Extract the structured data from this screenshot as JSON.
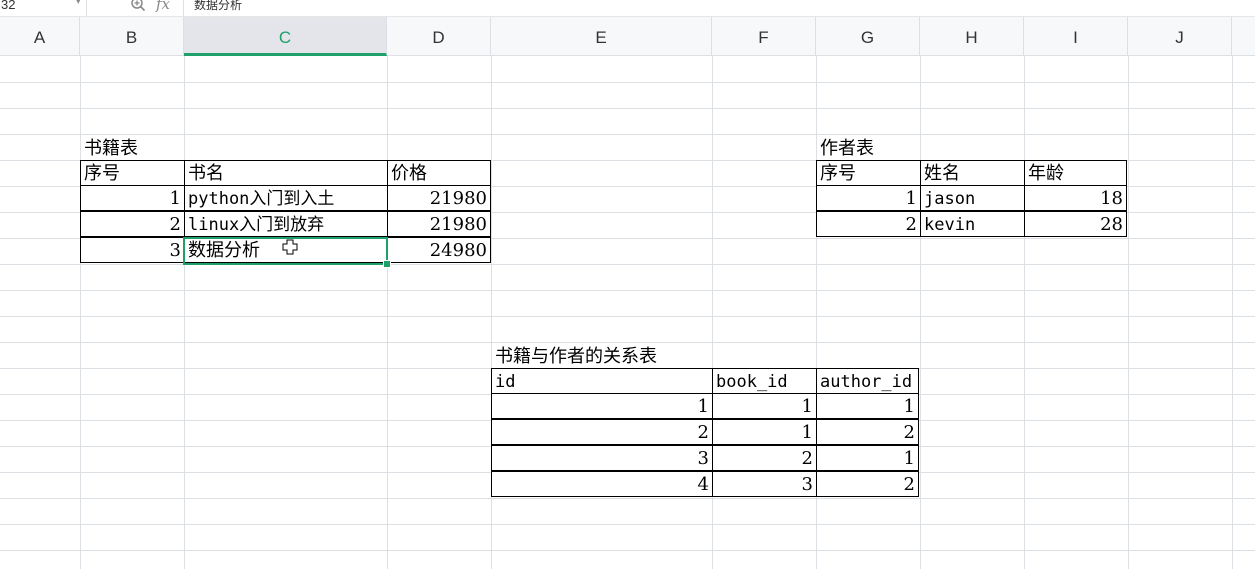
{
  "formula_bar": {
    "name_box": "32",
    "fx_label": "fx",
    "formula_value": "数据分析"
  },
  "columns": [
    "A",
    "B",
    "C",
    "D",
    "E",
    "F",
    "G",
    "H",
    "I",
    "J"
  ],
  "active_column": "C",
  "books_table": {
    "title": "书籍表",
    "headers": [
      "序号",
      "书名",
      "价格"
    ],
    "rows": [
      [
        "1",
        "python入门到入土",
        "21980"
      ],
      [
        "2",
        "linux入门到放弃",
        "21980"
      ],
      [
        "3",
        "数据分析",
        "24980"
      ]
    ]
  },
  "authors_table": {
    "title": "作者表",
    "headers": [
      "序号",
      "姓名",
      "年龄"
    ],
    "rows": [
      [
        "1",
        "jason",
        "18"
      ],
      [
        "2",
        "kevin",
        "28"
      ]
    ]
  },
  "relation_table": {
    "title": "书籍与作者的关系表",
    "headers": [
      "id",
      "book_id",
      "author_id"
    ],
    "rows": [
      [
        "1",
        "1",
        "1"
      ],
      [
        "2",
        "1",
        "2"
      ],
      [
        "3",
        "2",
        "1"
      ],
      [
        "4",
        "3",
        "2"
      ]
    ]
  },
  "colors": {
    "accent": "#1f9f6a",
    "header_bg": "#f7f8fa",
    "gridline": "#dcdfe4"
  }
}
